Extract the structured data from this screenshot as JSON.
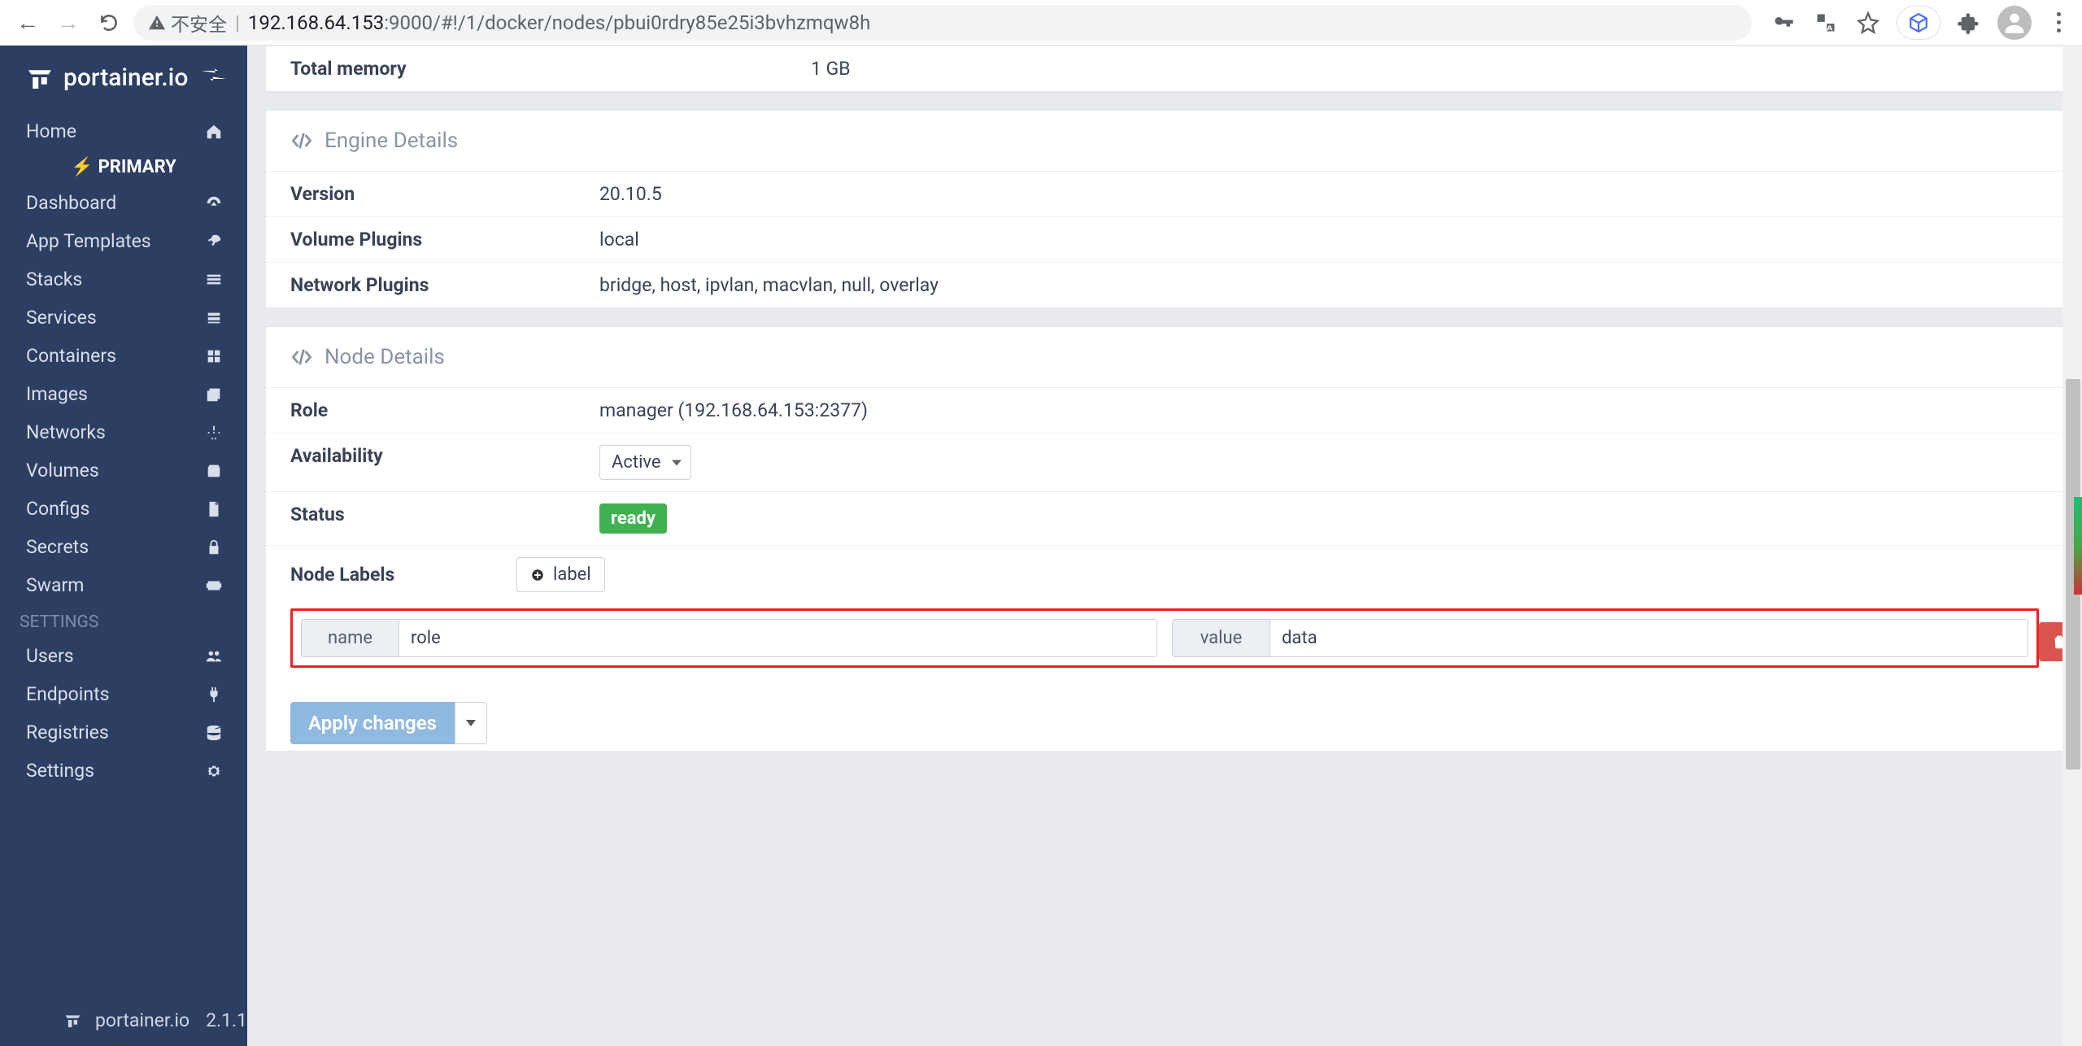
{
  "browser": {
    "insecure_label": "不安全",
    "url_host": "192.168.64.153",
    "url_port": ":9000",
    "url_path": "/#!/1/docker/nodes/pbui0rdry85e25i3bvhzmqw8h"
  },
  "sidebar": {
    "brand": "portainer.io",
    "group_label": "PRIMARY",
    "items_top": [
      {
        "label": "Home",
        "icon": "home"
      }
    ],
    "items": [
      {
        "label": "Dashboard",
        "icon": "dashboard"
      },
      {
        "label": "App Templates",
        "icon": "rocket"
      },
      {
        "label": "Stacks",
        "icon": "stacks"
      },
      {
        "label": "Services",
        "icon": "list"
      },
      {
        "label": "Containers",
        "icon": "containers"
      },
      {
        "label": "Images",
        "icon": "images"
      },
      {
        "label": "Networks",
        "icon": "network"
      },
      {
        "label": "Volumes",
        "icon": "volume"
      },
      {
        "label": "Configs",
        "icon": "file"
      },
      {
        "label": "Secrets",
        "icon": "lock"
      },
      {
        "label": "Swarm",
        "icon": "swarm"
      }
    ],
    "settings_heading": "SETTINGS",
    "settings_items": [
      {
        "label": "Users",
        "icon": "users"
      },
      {
        "label": "Endpoints",
        "icon": "plug"
      },
      {
        "label": "Registries",
        "icon": "database"
      },
      {
        "label": "Settings",
        "icon": "cogs"
      }
    ],
    "footer_brand": "portainer.io",
    "footer_version": "2.1.1"
  },
  "panels": {
    "host": {
      "rows": [
        {
          "k": "Total memory",
          "v": "1 GB"
        }
      ]
    },
    "engine": {
      "title": "Engine Details",
      "rows": [
        {
          "k": "Version",
          "v": "20.10.5"
        },
        {
          "k": "Volume Plugins",
          "v": "local"
        },
        {
          "k": "Network Plugins",
          "v": "bridge, host, ipvlan, macvlan, null, overlay"
        }
      ]
    },
    "node": {
      "title": "Node Details",
      "role_k": "Role",
      "role_v": "manager (192.168.64.153:2377)",
      "avail_k": "Availability",
      "avail_v": "Active",
      "status_k": "Status",
      "status_v": "ready",
      "labels_k": "Node Labels",
      "add_label_btn": "label",
      "label_name_addon": "name",
      "label_name_value": "role",
      "label_value_addon": "value",
      "label_value_value": "data",
      "apply_btn": "Apply changes"
    }
  }
}
